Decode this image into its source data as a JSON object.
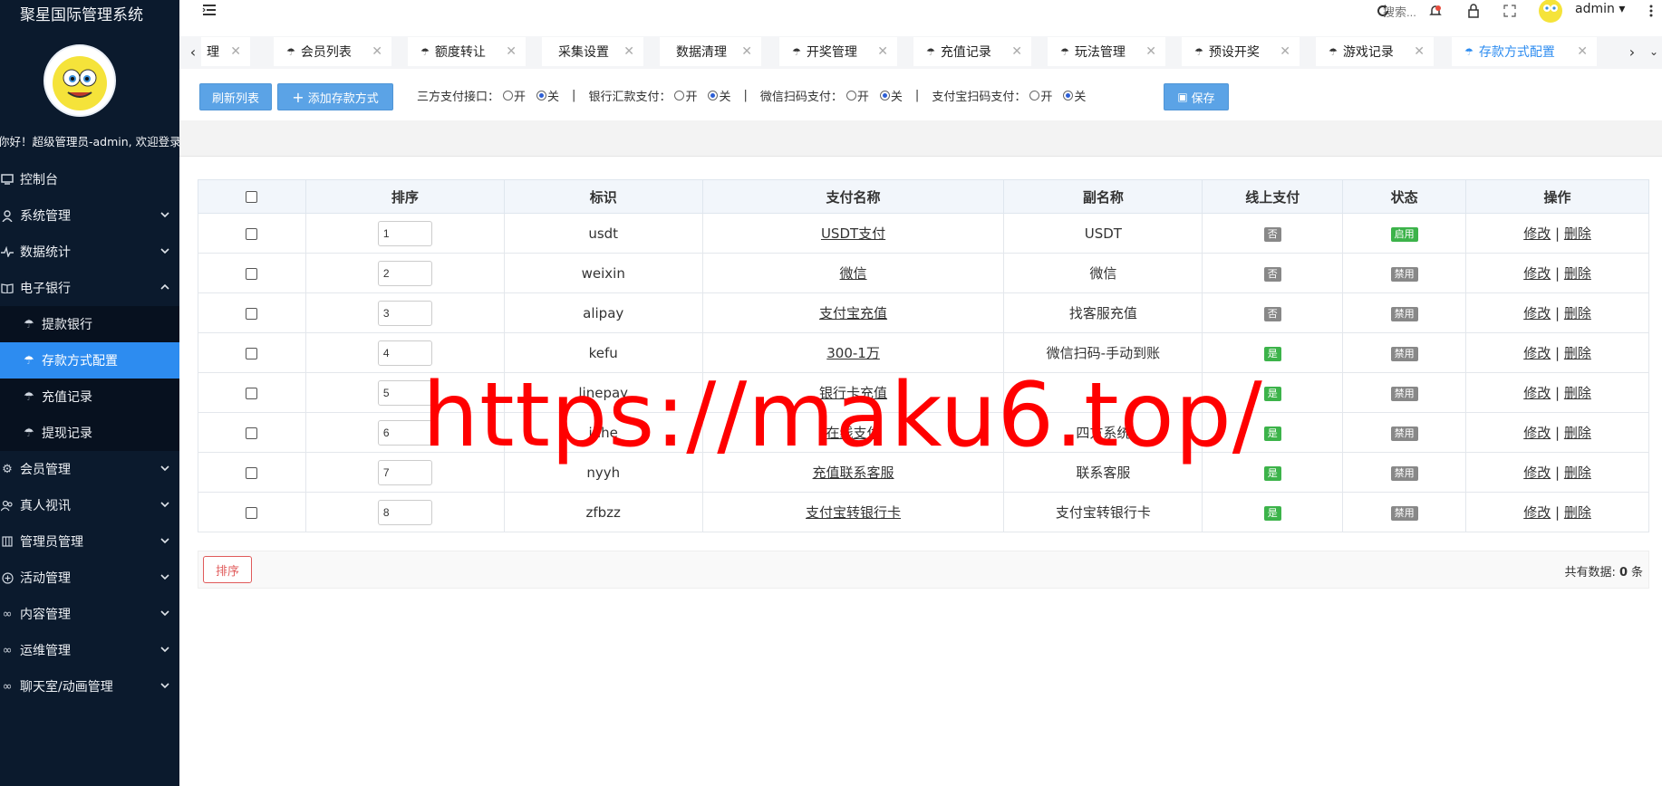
{
  "app": {
    "title": "聚星国际管理系统",
    "welcome": "你好！超级管理员-admin, 欢迎登录"
  },
  "sidebar": {
    "items": [
      {
        "label": "控制台",
        "icon": "dashboard-icon"
      },
      {
        "label": "系统管理",
        "icon": "user-icon"
      },
      {
        "label": "数据统计",
        "icon": "pulse-icon"
      },
      {
        "label": "电子银行",
        "icon": "book-icon",
        "expanded": true
      },
      {
        "label": "会员管理",
        "icon": "gear-icon"
      },
      {
        "label": "真人视讯",
        "icon": "users-icon"
      },
      {
        "label": "管理员管理",
        "icon": "grid-icon"
      },
      {
        "label": "活动管理",
        "icon": "plus-circle-icon"
      },
      {
        "label": "内容管理",
        "icon": "link-icon"
      },
      {
        "label": "运维管理",
        "icon": "link-icon"
      },
      {
        "label": "聊天室/动画管理",
        "icon": "link-icon"
      }
    ],
    "sub_items": [
      {
        "label": "提款银行",
        "active": false
      },
      {
        "label": "存款方式配置",
        "active": true
      },
      {
        "label": "充值记录",
        "active": false
      },
      {
        "label": "提现记录",
        "active": false
      }
    ]
  },
  "topbar": {
    "search_placeholder": "搜索...",
    "user": "admin"
  },
  "tabs": [
    {
      "label": "理"
    },
    {
      "label": "会员列表"
    },
    {
      "label": "额度转让"
    },
    {
      "label": "采集设置"
    },
    {
      "label": "数据清理"
    },
    {
      "label": "开奖管理"
    },
    {
      "label": "充值记录"
    },
    {
      "label": "玩法管理"
    },
    {
      "label": "预设开奖"
    },
    {
      "label": "游戏记录"
    },
    {
      "label": "存款方式配置",
      "active": true
    }
  ],
  "toolbar": {
    "refresh_label": "刷新列表",
    "add_label": "添加存款方式",
    "save_label": "保存",
    "on_label": "开",
    "off_label": "关",
    "options": [
      {
        "label": "三方支付接口：",
        "value": "关"
      },
      {
        "label": "银行汇款支付：",
        "value": "关"
      },
      {
        "label": "微信扫码支付：",
        "value": "关"
      },
      {
        "label": "支付宝扫码支付：",
        "value": "关"
      }
    ]
  },
  "table": {
    "columns": [
      "排序",
      "标识",
      "支付名称",
      "副名称",
      "线上支付",
      "状态",
      "操作"
    ],
    "edit_label": "修改",
    "delete_label": "删除",
    "rows": [
      {
        "sort": "1",
        "code": "usdt",
        "name": "USDT支付",
        "alias": "USDT",
        "online": "否",
        "status": "启用"
      },
      {
        "sort": "2",
        "code": "weixin",
        "name": "微信",
        "alias": "微信",
        "online": "否",
        "status": "禁用"
      },
      {
        "sort": "3",
        "code": "alipay",
        "name": "支付宝充值",
        "alias": "找客服充值",
        "online": "否",
        "status": "禁用"
      },
      {
        "sort": "4",
        "code": "kefu",
        "name": "300-1万",
        "alias": "微信扫码-手动到账",
        "online": "是",
        "status": "禁用"
      },
      {
        "sort": "5",
        "code": "linepay",
        "name": "银行卡充值",
        "alias": "",
        "online": "是",
        "status": "禁用"
      },
      {
        "sort": "6",
        "code": "juhe",
        "name": "在线支付",
        "alias": "四方系统",
        "online": "是",
        "status": "禁用"
      },
      {
        "sort": "7",
        "code": "nyyh",
        "name": "充值联系客服",
        "alias": "联系客服",
        "online": "是",
        "status": "禁用"
      },
      {
        "sort": "8",
        "code": "zfbzz",
        "name": "支付宝转银行卡",
        "alias": "支付宝转银行卡",
        "online": "是",
        "status": "禁用"
      }
    ]
  },
  "footer": {
    "sort_button": "排序",
    "count_prefix": "共有数据:",
    "count": "0",
    "count_suffix": "条"
  },
  "watermark": "https://maku6.top/"
}
